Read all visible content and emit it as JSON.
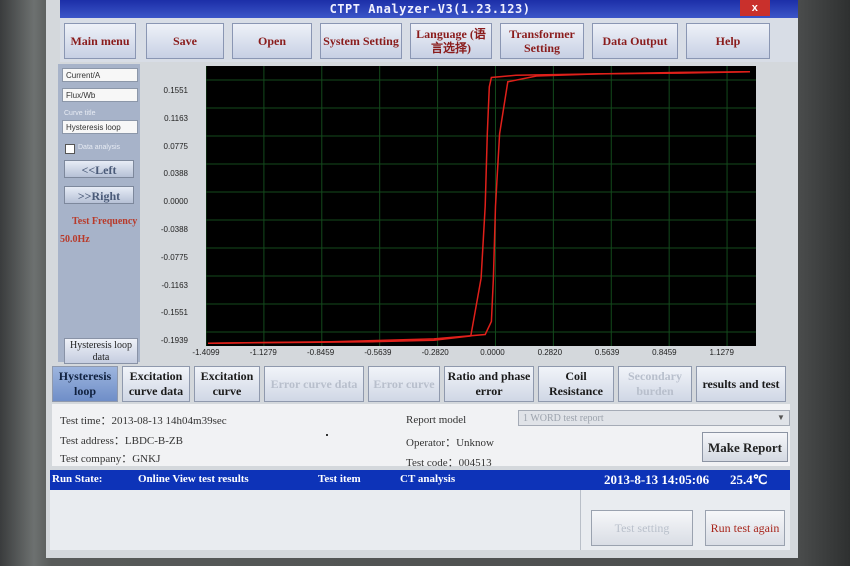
{
  "window": {
    "title": "CTPT Analyzer-V3(1.23.123)",
    "close_label": "x"
  },
  "menu": [
    {
      "label": "Main menu"
    },
    {
      "label": "Save"
    },
    {
      "label": "Open"
    },
    {
      "label": "System Setting"
    },
    {
      "label": "Language (语言选择)"
    },
    {
      "label": "Transformer Setting"
    },
    {
      "label": "Data Output"
    },
    {
      "label": "Help"
    }
  ],
  "sidebar": {
    "field_y": "Current/A",
    "field_x": "Flux/Wb",
    "curve_title_label": "Curve title",
    "curve_title": "Hysteresis loop",
    "data_analysis_label": "Data analysis",
    "left_button": "<<Left",
    "right_button": ">>Right",
    "freq_label": "Test Frequency",
    "freq_value": "50.0Hz",
    "hysteresis_data_button": "Hysteresis loop data"
  },
  "chart_data": {
    "type": "line",
    "title": "Hysteresis loop",
    "xlabel": "",
    "ylabel": "",
    "xlim": [
      -1.4099,
      1.269
    ],
    "ylim": [
      -0.1939,
      0.1939
    ],
    "x_ticks": [
      "-1.4099",
      "-1.1279",
      "-0.8459",
      "-0.5639",
      "-0.2820",
      "0.0000",
      "0.2820",
      "0.5639",
      "0.8459",
      "1.1279"
    ],
    "y_ticks": [
      "0.1551",
      "0.1163",
      "0.0775",
      "0.0388",
      "0.0000",
      "-0.0388",
      "-0.0775",
      "-0.1163",
      "-0.1551",
      "-0.1939"
    ],
    "grid": true,
    "background": "#000000",
    "line_color": "#e0201a",
    "series": [
      {
        "x": [
          -1.4,
          -1.0,
          -0.6,
          -0.3,
          -0.12,
          -0.07,
          -0.05,
          -0.04,
          -0.03,
          -0.02,
          0.1,
          0.5,
          0.9,
          1.24
        ],
        "y": [
          -0.19,
          -0.189,
          -0.188,
          -0.186,
          -0.18,
          -0.1,
          0.0,
          0.1,
          0.165,
          0.178,
          0.181,
          0.183,
          0.184,
          0.186
        ]
      },
      {
        "x": [
          1.24,
          0.9,
          0.5,
          0.2,
          0.06,
          0.02,
          0.0,
          -0.01,
          -0.02,
          -0.05,
          -0.3,
          -0.8,
          -1.4
        ],
        "y": [
          0.186,
          0.185,
          0.183,
          0.18,
          0.172,
          0.1,
          0.0,
          -0.1,
          -0.16,
          -0.178,
          -0.184,
          -0.188,
          -0.19
        ]
      }
    ]
  },
  "tabs": [
    {
      "label": "Hysteresis loop",
      "state": "active"
    },
    {
      "label": "Excitation curve data",
      "state": "enabled"
    },
    {
      "label": "Excitation curve",
      "state": "enabled"
    },
    {
      "label": "Error curve data",
      "state": "disabled"
    },
    {
      "label": "Error curve",
      "state": "disabled"
    },
    {
      "label": "Ratio and phase error",
      "state": "enabled"
    },
    {
      "label": "Coil Resistance",
      "state": "enabled"
    },
    {
      "label": "Secondary burden",
      "state": "disabled"
    },
    {
      "label": "results and test",
      "state": "enabled"
    }
  ],
  "info": {
    "test_time": "Test time：2013-08-13 14h04m39sec",
    "test_address": "Test address：LBDC-B-ZB",
    "test_company": "Test company：GNKJ",
    "report_model_label": "Report model",
    "report_model_value": "1 WORD test report",
    "operator": "Operator：Unknow",
    "test_code": "Test code：004513",
    "make_report": "Make Report"
  },
  "status": {
    "run_state_label": "Run State:",
    "run_state": "Online  View test results",
    "test_item_label": "Test item",
    "test_item": "CT analysis",
    "datetime": "2013-8-13 14:05:06",
    "temperature": "25.4℃"
  },
  "bottom": {
    "test_setting": "Test setting",
    "run_again": "Run test again"
  }
}
